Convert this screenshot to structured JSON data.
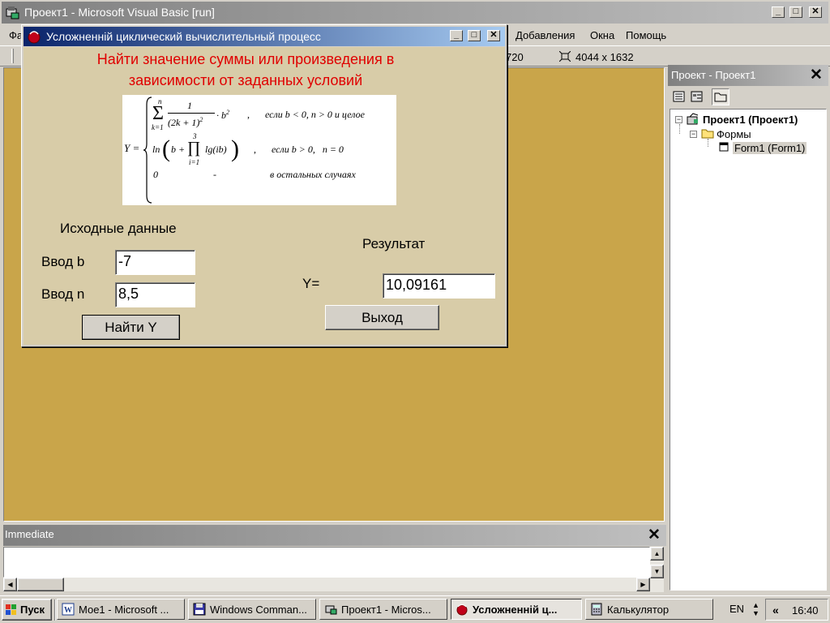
{
  "ide": {
    "title": "Проект1 - Microsoft Visual Basic [run]",
    "menu": {
      "file": "Фа",
      "addins": "Добавления",
      "window": "Окна",
      "help": "Помощь"
    },
    "toolbar": {
      "position": "720",
      "size": "4044 x 1632"
    }
  },
  "form": {
    "title": "Усложненній циклический вычислительный процесс",
    "heading_line1": "Найти значение суммы или произведения в",
    "heading_line2": "зависимости от заданных условий",
    "formula": {
      "lhs": "Y =",
      "case1_cond": "если b < 0, n > 0 и целое",
      "case2_cond": "если b > 0,   n = 0",
      "case3_value": "0",
      "case3_dash": "-",
      "case3_cond": "в остальных случаях"
    },
    "input_header": "Исходные данные",
    "label_b": "Ввод b",
    "value_b": "-7",
    "label_n": "Ввод n",
    "value_n": "8,5",
    "find_button": "Найти Y",
    "result_header": "Результат",
    "y_label": "Y=",
    "y_value": "10,09161",
    "exit_button": "Выход"
  },
  "project_panel": {
    "title": "Проект - Проект1",
    "root": "Проект1 (Проект1)",
    "folder": "Формы",
    "item": "Form1 (Form1)"
  },
  "immediate": {
    "title": "Immediate"
  },
  "taskbar": {
    "start": "Пуск",
    "tasks": [
      "Мое1 - Microsoft ...",
      "Windows Comman...",
      "Проект1 - Micros...",
      "Усложненній ц...",
      "Калькулятор"
    ],
    "lang": "EN",
    "chevron": "«",
    "clock": "16:40"
  },
  "colors": {
    "workspace": "#c9a54a",
    "form_bg": "#d8cca8",
    "heading_red": "#e00000"
  }
}
